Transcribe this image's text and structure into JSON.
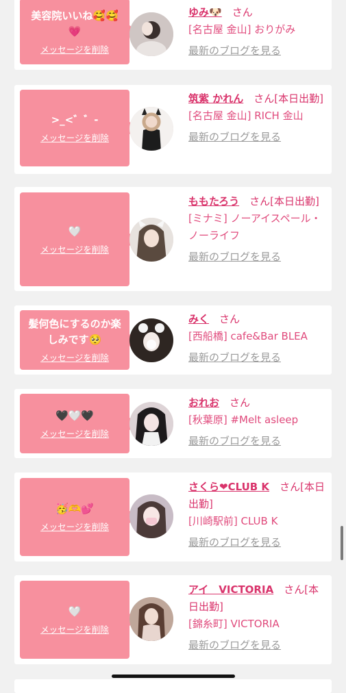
{
  "delete_label": "メッセージを削除",
  "blog_label": "最新のブログを見る",
  "san": "さん",
  "accent_color": "#f7909e",
  "name_color": "#d9336b",
  "cards": [
    {
      "message": "美容院いいね🥰🥰💗",
      "name": "ゆみ🐶",
      "suffix": "",
      "shop": "[名古屋 金山] おりがみ"
    },
    {
      "message": ">_<゛゛-",
      "name": "筑紫 かれん",
      "suffix": "[本日出勤]",
      "shop": "[名古屋 金山] RICH 金山"
    },
    {
      "message": "🤍",
      "name": "ももたろう",
      "suffix": "[本日出勤]",
      "shop": "[ミナミ] ノーアイスペール・ノーライフ"
    },
    {
      "message": "髪何色にするのか楽しみです🥺",
      "name": "みく",
      "suffix": "",
      "shop": "[西船橋] cafe&Bar BLEA"
    },
    {
      "message": "🖤🤍🖤",
      "name": "おれお",
      "suffix": "",
      "shop": "[秋葉原] #Melt asleep"
    },
    {
      "message": "🥳🫶💕",
      "name": "さくら❤CLUB K",
      "suffix": "[本日出勤]",
      "shop": "[川崎駅前] CLUB K"
    },
    {
      "message": "🤍",
      "name": "アイ　VICTORIA",
      "suffix": "[本日出勤]",
      "shop": "[錦糸町] VICTORIA"
    }
  ]
}
